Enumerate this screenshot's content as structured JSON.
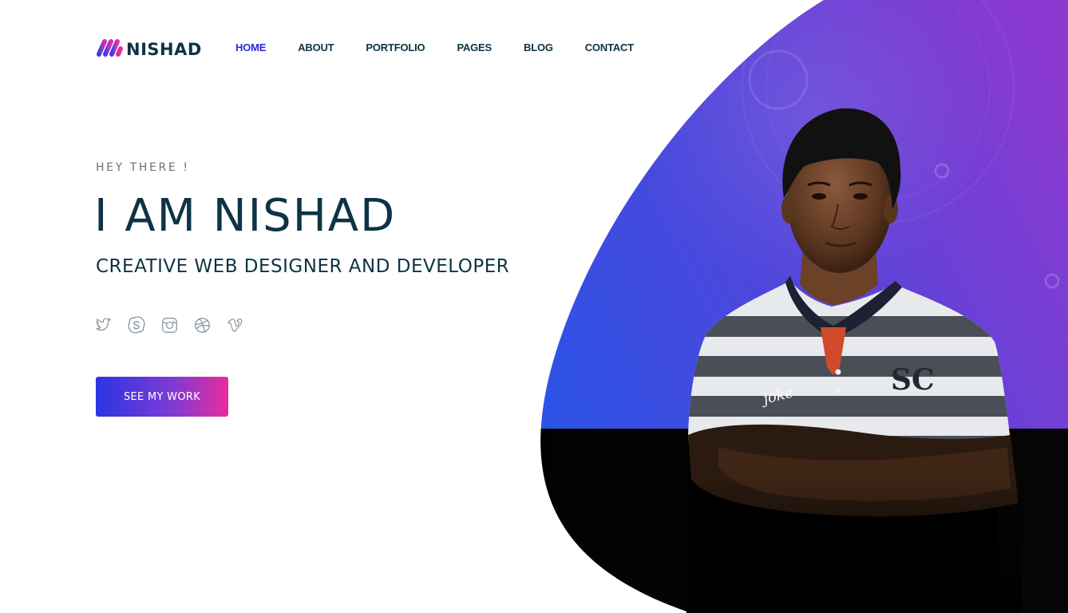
{
  "brand": {
    "name": "NISHAD",
    "colors": {
      "primary_text": "#0e3345",
      "accent_blue": "#2b27d8",
      "gradient_start": "#2b35e4",
      "gradient_end": "#e62c9f"
    }
  },
  "nav": {
    "items": [
      {
        "label": "HOME",
        "active": true
      },
      {
        "label": "ABOUT",
        "active": false
      },
      {
        "label": "PORTFOLIO",
        "active": false
      },
      {
        "label": "PAGES",
        "active": false
      },
      {
        "label": "BLOG",
        "active": false
      },
      {
        "label": "CONTACT",
        "active": false
      }
    ]
  },
  "hero": {
    "greeting": "HEY THERE !",
    "title": "I AM NISHAD",
    "subtitle": "CREATIVE WEB DESIGNER AND DEVELOPER",
    "cta_label": "SEE MY WORK",
    "socials": [
      {
        "icon": "twitter-icon"
      },
      {
        "icon": "skype-icon"
      },
      {
        "icon": "instagram-icon"
      },
      {
        "icon": "dribbble-icon"
      },
      {
        "icon": "vimeo-icon"
      }
    ],
    "shirt_text": {
      "chest_logo": "SC",
      "chest_word": "joke"
    }
  }
}
